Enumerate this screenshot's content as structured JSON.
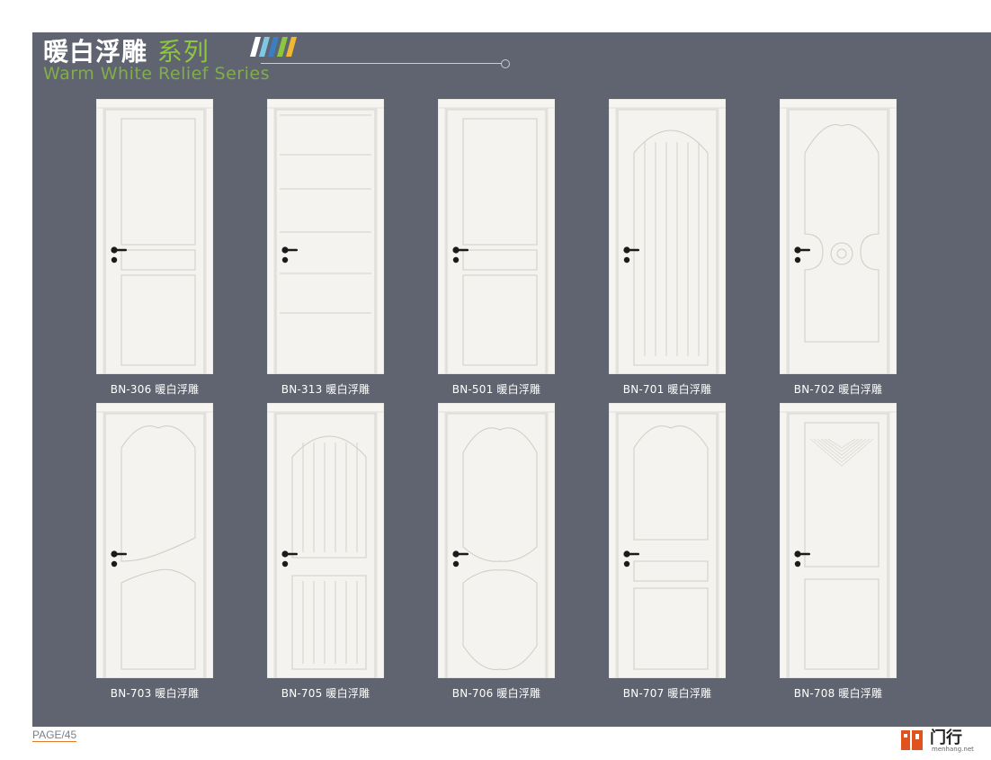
{
  "header": {
    "title_cn_main": "暖白浮雕",
    "title_cn_accent": "系列",
    "title_en": "Warm White Relief Series"
  },
  "doors": [
    {
      "code": "BN-306 暖白浮雕",
      "style": "306"
    },
    {
      "code": "BN-313 暖白浮雕",
      "style": "313"
    },
    {
      "code": "BN-501 暖白浮雕",
      "style": "501"
    },
    {
      "code": "BN-701 暖白浮雕",
      "style": "701"
    },
    {
      "code": "BN-702 暖白浮雕",
      "style": "702"
    },
    {
      "code": "BN-703 暖白浮雕",
      "style": "703"
    },
    {
      "code": "BN-705 暖白浮雕",
      "style": "705"
    },
    {
      "code": "BN-706 暖白浮雕",
      "style": "706"
    },
    {
      "code": "BN-707 暖白浮雕",
      "style": "707"
    },
    {
      "code": "BN-708 暖白浮雕",
      "style": "708"
    }
  ],
  "footer": {
    "page_label": "PAGE",
    "page_number": "/45"
  },
  "brand": {
    "name_cn": "门行",
    "name_en": "menhang.net",
    "color": "#e0531f"
  },
  "colors": {
    "panel": "#5f6470",
    "accent_green": "#8dc63f",
    "door_white": "#f3f2ee"
  }
}
